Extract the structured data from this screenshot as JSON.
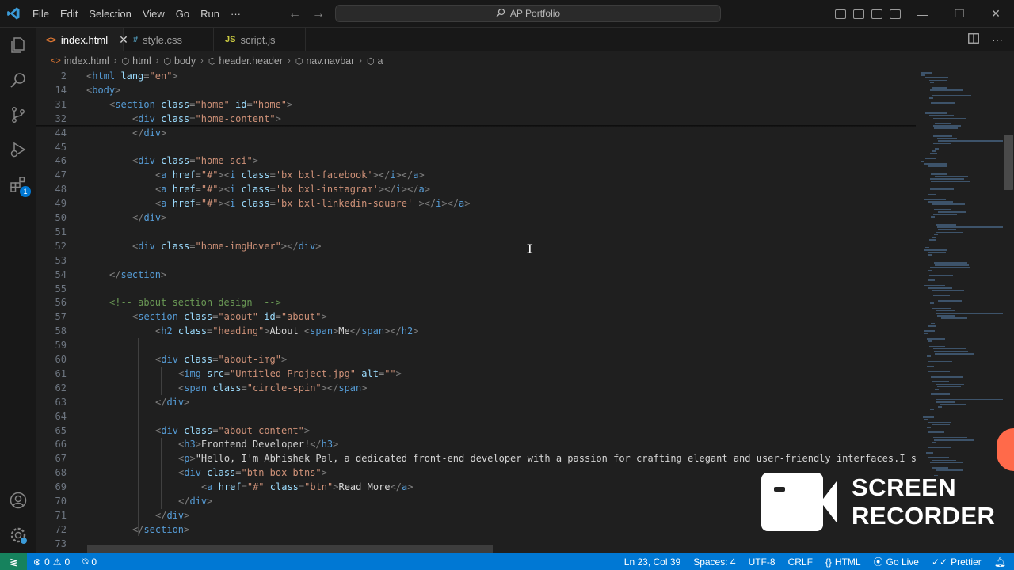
{
  "window": {
    "title": "AP Portfolio",
    "menus": [
      "File",
      "Edit",
      "Selection",
      "View",
      "Go",
      "Run",
      "···"
    ]
  },
  "tabs": [
    {
      "label": "index.html",
      "icon": "<>",
      "icon_color": "#e37933",
      "active": true
    },
    {
      "label": "style.css",
      "icon": "#",
      "icon_color": "#519aba",
      "active": false
    },
    {
      "label": "script.js",
      "icon": "JS",
      "icon_color": "#cbcb41",
      "active": false
    }
  ],
  "breadcrumb": [
    "index.html",
    "html",
    "body",
    "header.header",
    "nav.navbar",
    "a"
  ],
  "activity": {
    "extensions_badge": "1"
  },
  "editor": {
    "lines": [
      {
        "n": "2",
        "indent": 0,
        "tokens": [
          [
            "punc",
            "<"
          ],
          [
            "tag",
            "html"
          ],
          [
            "txt",
            " "
          ],
          [
            "attr",
            "lang"
          ],
          [
            "punc",
            "="
          ],
          [
            "str",
            "\"en\""
          ],
          [
            "punc",
            ">"
          ]
        ]
      },
      {
        "n": "14",
        "indent": 0,
        "tokens": [
          [
            "punc",
            "<"
          ],
          [
            "tag",
            "body"
          ],
          [
            "punc",
            ">"
          ]
        ]
      },
      {
        "n": "31",
        "indent": 1,
        "tokens": [
          [
            "punc",
            "<"
          ],
          [
            "tag",
            "section"
          ],
          [
            "txt",
            " "
          ],
          [
            "attr",
            "class"
          ],
          [
            "punc",
            "="
          ],
          [
            "str",
            "\"home\""
          ],
          [
            "txt",
            " "
          ],
          [
            "attr",
            "id"
          ],
          [
            "punc",
            "="
          ],
          [
            "str",
            "\"home\""
          ],
          [
            "punc",
            ">"
          ]
        ]
      },
      {
        "n": "32",
        "indent": 2,
        "tokens": [
          [
            "punc",
            "<"
          ],
          [
            "tag",
            "div"
          ],
          [
            "txt",
            " "
          ],
          [
            "attr",
            "class"
          ],
          [
            "punc",
            "="
          ],
          [
            "str",
            "\"home-content\""
          ],
          [
            "punc",
            ">"
          ]
        ]
      },
      {
        "n": "44",
        "indent": 2,
        "tokens": [
          [
            "punc",
            "</"
          ],
          [
            "tag",
            "div"
          ],
          [
            "punc",
            ">"
          ]
        ]
      },
      {
        "n": "45",
        "indent": 0,
        "tokens": []
      },
      {
        "n": "46",
        "indent": 2,
        "tokens": [
          [
            "punc",
            "<"
          ],
          [
            "tag",
            "div"
          ],
          [
            "txt",
            " "
          ],
          [
            "attr",
            "class"
          ],
          [
            "punc",
            "="
          ],
          [
            "str",
            "\"home-sci\""
          ],
          [
            "punc",
            ">"
          ]
        ]
      },
      {
        "n": "47",
        "indent": 3,
        "tokens": [
          [
            "punc",
            "<"
          ],
          [
            "tag",
            "a"
          ],
          [
            "txt",
            " "
          ],
          [
            "attr",
            "href"
          ],
          [
            "punc",
            "="
          ],
          [
            "str",
            "\"#\""
          ],
          [
            "punc",
            "><"
          ],
          [
            "tag",
            "i"
          ],
          [
            "txt",
            " "
          ],
          [
            "attr",
            "class"
          ],
          [
            "punc",
            "="
          ],
          [
            "str",
            "'bx bxl-facebook'"
          ],
          [
            "punc",
            "></"
          ],
          [
            "tag",
            "i"
          ],
          [
            "punc",
            "></"
          ],
          [
            "tag",
            "a"
          ],
          [
            "punc",
            ">"
          ]
        ]
      },
      {
        "n": "48",
        "indent": 3,
        "tokens": [
          [
            "punc",
            "<"
          ],
          [
            "tag",
            "a"
          ],
          [
            "txt",
            " "
          ],
          [
            "attr",
            "href"
          ],
          [
            "punc",
            "="
          ],
          [
            "str",
            "\"#\""
          ],
          [
            "punc",
            "><"
          ],
          [
            "tag",
            "i"
          ],
          [
            "txt",
            " "
          ],
          [
            "attr",
            "class"
          ],
          [
            "punc",
            "="
          ],
          [
            "str",
            "'bx bxl-instagram'"
          ],
          [
            "punc",
            "></"
          ],
          [
            "tag",
            "i"
          ],
          [
            "punc",
            "></"
          ],
          [
            "tag",
            "a"
          ],
          [
            "punc",
            ">"
          ]
        ]
      },
      {
        "n": "49",
        "indent": 3,
        "tokens": [
          [
            "punc",
            "<"
          ],
          [
            "tag",
            "a"
          ],
          [
            "txt",
            " "
          ],
          [
            "attr",
            "href"
          ],
          [
            "punc",
            "="
          ],
          [
            "str",
            "\"#\""
          ],
          [
            "punc",
            "><"
          ],
          [
            "tag",
            "i"
          ],
          [
            "txt",
            " "
          ],
          [
            "attr",
            "class"
          ],
          [
            "punc",
            "="
          ],
          [
            "str",
            "'bx bxl-linkedin-square'"
          ],
          [
            "txt",
            " "
          ],
          [
            "punc",
            "></"
          ],
          [
            "tag",
            "i"
          ],
          [
            "punc",
            "></"
          ],
          [
            "tag",
            "a"
          ],
          [
            "punc",
            ">"
          ]
        ]
      },
      {
        "n": "50",
        "indent": 2,
        "tokens": [
          [
            "punc",
            "</"
          ],
          [
            "tag",
            "div"
          ],
          [
            "punc",
            ">"
          ]
        ]
      },
      {
        "n": "51",
        "indent": 0,
        "tokens": []
      },
      {
        "n": "52",
        "indent": 2,
        "tokens": [
          [
            "punc",
            "<"
          ],
          [
            "tag",
            "div"
          ],
          [
            "txt",
            " "
          ],
          [
            "attr",
            "class"
          ],
          [
            "punc",
            "="
          ],
          [
            "str",
            "\"home-imgHover\""
          ],
          [
            "punc",
            "></"
          ],
          [
            "tag",
            "div"
          ],
          [
            "punc",
            ">"
          ]
        ]
      },
      {
        "n": "53",
        "indent": 0,
        "tokens": []
      },
      {
        "n": "54",
        "indent": 1,
        "tokens": [
          [
            "punc",
            "</"
          ],
          [
            "tag",
            "section"
          ],
          [
            "punc",
            ">"
          ]
        ]
      },
      {
        "n": "55",
        "indent": 0,
        "tokens": []
      },
      {
        "n": "56",
        "indent": 1,
        "tokens": [
          [
            "cmt",
            "<!-- about section design  -->"
          ]
        ]
      },
      {
        "n": "57",
        "indent": 2,
        "tokens": [
          [
            "punc",
            "<"
          ],
          [
            "tag",
            "section"
          ],
          [
            "txt",
            " "
          ],
          [
            "attr",
            "class"
          ],
          [
            "punc",
            "="
          ],
          [
            "str",
            "\"about\""
          ],
          [
            "txt",
            " "
          ],
          [
            "attr",
            "id"
          ],
          [
            "punc",
            "="
          ],
          [
            "str",
            "\"about\""
          ],
          [
            "punc",
            ">"
          ]
        ]
      },
      {
        "n": "58",
        "indent": 3,
        "tokens": [
          [
            "punc",
            "<"
          ],
          [
            "tag",
            "h2"
          ],
          [
            "txt",
            " "
          ],
          [
            "attr",
            "class"
          ],
          [
            "punc",
            "="
          ],
          [
            "str",
            "\"heading\""
          ],
          [
            "punc",
            ">"
          ],
          [
            "txt",
            "About "
          ],
          [
            "punc",
            "<"
          ],
          [
            "tag",
            "span"
          ],
          [
            "punc",
            ">"
          ],
          [
            "txt",
            "Me"
          ],
          [
            "punc",
            "</"
          ],
          [
            "tag",
            "span"
          ],
          [
            "punc",
            "></"
          ],
          [
            "tag",
            "h2"
          ],
          [
            "punc",
            ">"
          ]
        ]
      },
      {
        "n": "59",
        "indent": 0,
        "tokens": []
      },
      {
        "n": "60",
        "indent": 3,
        "tokens": [
          [
            "punc",
            "<"
          ],
          [
            "tag",
            "div"
          ],
          [
            "txt",
            " "
          ],
          [
            "attr",
            "class"
          ],
          [
            "punc",
            "="
          ],
          [
            "str",
            "\"about-img\""
          ],
          [
            "punc",
            ">"
          ]
        ]
      },
      {
        "n": "61",
        "indent": 4,
        "tokens": [
          [
            "punc",
            "<"
          ],
          [
            "tag",
            "img"
          ],
          [
            "txt",
            " "
          ],
          [
            "attr",
            "src"
          ],
          [
            "punc",
            "="
          ],
          [
            "str",
            "\"Untitled Project.jpg\""
          ],
          [
            "txt",
            " "
          ],
          [
            "attr",
            "alt"
          ],
          [
            "punc",
            "="
          ],
          [
            "str",
            "\"\""
          ],
          [
            "punc",
            ">"
          ]
        ]
      },
      {
        "n": "62",
        "indent": 4,
        "tokens": [
          [
            "punc",
            "<"
          ],
          [
            "tag",
            "span"
          ],
          [
            "txt",
            " "
          ],
          [
            "attr",
            "class"
          ],
          [
            "punc",
            "="
          ],
          [
            "str",
            "\"circle-spin\""
          ],
          [
            "punc",
            "></"
          ],
          [
            "tag",
            "span"
          ],
          [
            "punc",
            ">"
          ]
        ]
      },
      {
        "n": "63",
        "indent": 3,
        "tokens": [
          [
            "punc",
            "</"
          ],
          [
            "tag",
            "div"
          ],
          [
            "punc",
            ">"
          ]
        ]
      },
      {
        "n": "64",
        "indent": 0,
        "tokens": []
      },
      {
        "n": "65",
        "indent": 3,
        "tokens": [
          [
            "punc",
            "<"
          ],
          [
            "tag",
            "div"
          ],
          [
            "txt",
            " "
          ],
          [
            "attr",
            "class"
          ],
          [
            "punc",
            "="
          ],
          [
            "str",
            "\"about-content\""
          ],
          [
            "punc",
            ">"
          ]
        ]
      },
      {
        "n": "66",
        "indent": 4,
        "tokens": [
          [
            "punc",
            "<"
          ],
          [
            "tag",
            "h3"
          ],
          [
            "punc",
            ">"
          ],
          [
            "txt",
            "Frontend Developer!"
          ],
          [
            "punc",
            "</"
          ],
          [
            "tag",
            "h3"
          ],
          [
            "punc",
            ">"
          ]
        ]
      },
      {
        "n": "67",
        "indent": 4,
        "tokens": [
          [
            "punc",
            "<"
          ],
          [
            "tag",
            "p"
          ],
          [
            "punc",
            ">"
          ],
          [
            "txt",
            "\"Hello, I'm Abhishek Pal, a dedicated front-end developer with a passion for crafting elegant and user-friendly interfaces.I s"
          ]
        ]
      },
      {
        "n": "68",
        "indent": 4,
        "tokens": [
          [
            "punc",
            "<"
          ],
          [
            "tag",
            "div"
          ],
          [
            "txt",
            " "
          ],
          [
            "attr",
            "class"
          ],
          [
            "punc",
            "="
          ],
          [
            "str",
            "\"btn-box btns\""
          ],
          [
            "punc",
            ">"
          ]
        ]
      },
      {
        "n": "69",
        "indent": 5,
        "tokens": [
          [
            "punc",
            "<"
          ],
          [
            "tag",
            "a"
          ],
          [
            "txt",
            " "
          ],
          [
            "attr",
            "href"
          ],
          [
            "punc",
            "="
          ],
          [
            "str",
            "\"#\""
          ],
          [
            "txt",
            " "
          ],
          [
            "attr",
            "class"
          ],
          [
            "punc",
            "="
          ],
          [
            "str",
            "\"btn\""
          ],
          [
            "punc",
            ">"
          ],
          [
            "txt",
            "Read More"
          ],
          [
            "punc",
            "</"
          ],
          [
            "tag",
            "a"
          ],
          [
            "punc",
            ">"
          ]
        ]
      },
      {
        "n": "70",
        "indent": 4,
        "tokens": [
          [
            "punc",
            "</"
          ],
          [
            "tag",
            "div"
          ],
          [
            "punc",
            ">"
          ]
        ]
      },
      {
        "n": "71",
        "indent": 3,
        "tokens": [
          [
            "punc",
            "</"
          ],
          [
            "tag",
            "div"
          ],
          [
            "punc",
            ">"
          ]
        ]
      },
      {
        "n": "72",
        "indent": 2,
        "tokens": [
          [
            "punc",
            "</"
          ],
          [
            "tag",
            "section"
          ],
          [
            "punc",
            ">"
          ]
        ]
      },
      {
        "n": "73",
        "indent": 0,
        "tokens": []
      }
    ]
  },
  "overlay": {
    "recorder_line1": "SCREEN",
    "recorder_line2": "RECORDER"
  },
  "statusbar": {
    "errors": "0",
    "warnings": "0",
    "ports": "0",
    "position": "Ln 23, Col 39",
    "spaces": "Spaces: 4",
    "encoding": "UTF-8",
    "eol": "CRLF",
    "language": "HTML",
    "golive": "Go Live",
    "prettier": "Prettier"
  },
  "colors": {
    "accent": "#0078d4",
    "remote": "#16825d",
    "tag": "#569cd6",
    "attr": "#9cdcfe",
    "string": "#ce9178",
    "comment": "#6a9955"
  }
}
